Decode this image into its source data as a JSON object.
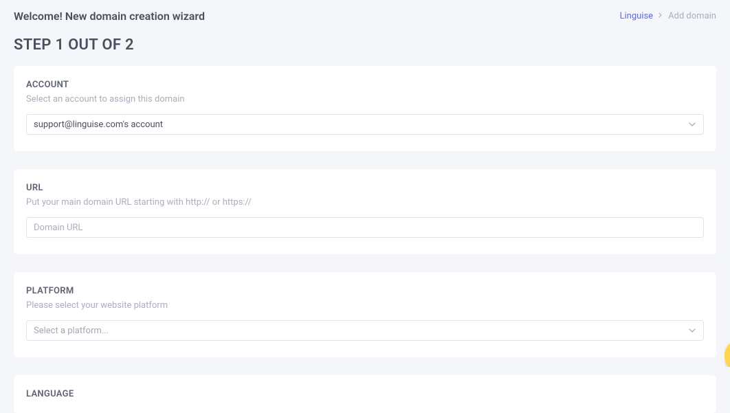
{
  "header": {
    "title": "Welcome! New domain creation wizard"
  },
  "breadcrumb": {
    "link_text": "Linguise",
    "current_text": "Add domain"
  },
  "step": {
    "heading": "STEP 1 OUT OF 2"
  },
  "account": {
    "label": "ACCOUNT",
    "sublabel": "Select an account to assign this domain",
    "selected": "support@linguise.com's account"
  },
  "url": {
    "label": "URL",
    "sublabel": "Put your main domain URL starting with http:// or https://",
    "placeholder": "Domain URL",
    "value": ""
  },
  "platform": {
    "label": "PLATFORM",
    "sublabel": "Please select your website platform",
    "placeholder": "Select a platform..."
  },
  "language": {
    "label": "LANGUAGE"
  }
}
